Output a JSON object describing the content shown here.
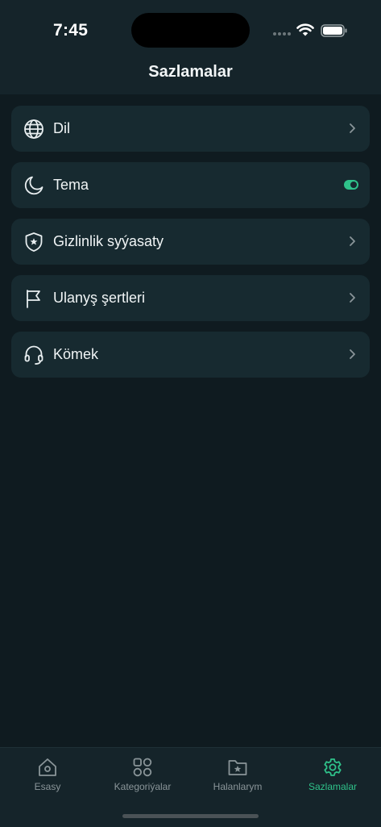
{
  "status_bar": {
    "time": "7:45"
  },
  "header": {
    "title": "Sazlamalar"
  },
  "settings": {
    "items": [
      {
        "label": "Dil",
        "icon": "globe-icon",
        "control": "chevron"
      },
      {
        "label": "Tema",
        "icon": "moon-icon",
        "control": "toggle"
      },
      {
        "label": "Gizlinlik syýasaty",
        "icon": "shield-star-icon",
        "control": "chevron"
      },
      {
        "label": "Ulanyş şertleri",
        "icon": "flag-icon",
        "control": "chevron"
      },
      {
        "label": "Kömek",
        "icon": "headset-icon",
        "control": "chevron"
      }
    ]
  },
  "tabbar": {
    "tabs": [
      {
        "label": "Esasy",
        "icon": "home-icon",
        "active": false
      },
      {
        "label": "Kategoriýalar",
        "icon": "grid-icon",
        "active": false
      },
      {
        "label": "Halanlarym",
        "icon": "folder-star-icon",
        "active": false
      },
      {
        "label": "Sazlamalar",
        "icon": "gear-icon",
        "active": true
      }
    ]
  },
  "colors": {
    "background": "#0f1b20",
    "surface": "#172a30",
    "header": "#15242a",
    "accent": "#2fc28a",
    "text": "#f0f4f5",
    "muted": "#8a9599"
  }
}
